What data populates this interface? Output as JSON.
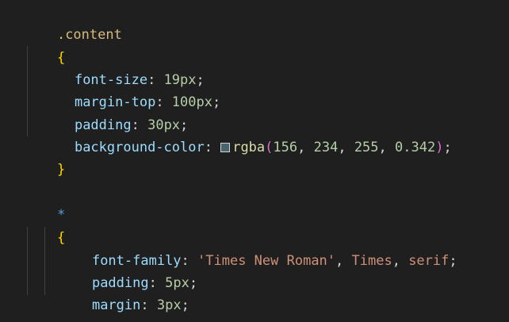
{
  "rule1": {
    "selector": ".content",
    "open_brace": "{",
    "close_brace": "}",
    "decls": [
      {
        "property": "font-size",
        "colon": ": ",
        "value": "19px",
        "semi": ";"
      },
      {
        "property": "margin-top",
        "colon": ": ",
        "value": "100px",
        "semi": ";"
      },
      {
        "property": "padding",
        "colon": ": ",
        "value": "30px",
        "semi": ";"
      }
    ],
    "bg": {
      "property": "background-color",
      "colon": ": ",
      "swatch_color": "#9ceaff57",
      "func": "rgba",
      "lparen": "(",
      "args": [
        "156",
        "234",
        "255",
        "0.342"
      ],
      "sep": ", ",
      "rparen": ")",
      "semi": ";"
    }
  },
  "rule2": {
    "selector": "*",
    "open_brace": "{",
    "close_brace": "}",
    "font_family": {
      "property": "font-family",
      "colon": ": ",
      "value1": "'Times New Roman'",
      "sep1": ", ",
      "value2": "Times",
      "sep2": ", ",
      "value3": "serif",
      "semi": ";"
    },
    "decls": [
      {
        "property": "padding",
        "colon": ": ",
        "value": "5px",
        "semi": ";"
      },
      {
        "property": "margin",
        "colon": ": ",
        "value": "3px",
        "semi": ";"
      }
    ]
  }
}
